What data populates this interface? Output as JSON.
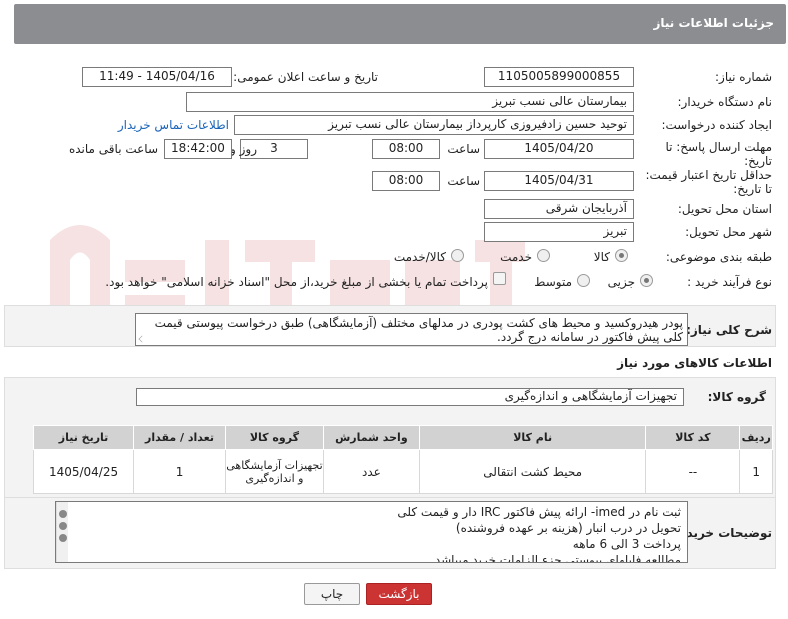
{
  "header": {
    "title": "جزئیات اطلاعات نیاز"
  },
  "fields": {
    "need_number": {
      "label": "شماره نیاز:",
      "value": "1105005899000855"
    },
    "announce_datetime": {
      "label": "تاریخ و ساعت اعلان عمومی:",
      "value": "1405/04/16 - 11:49"
    },
    "buyer_org": {
      "label": "نام دستگاه خریدار:",
      "value": "بیمارستان عالی نسب تبریز"
    },
    "requester": {
      "label": "ایجاد کننده درخواست:",
      "value": "توحید حسین زادفیروزی کارپرداز بیمارستان عالی نسب تبریز",
      "contact_link": "اطلاعات تماس خریدار"
    },
    "deadline": {
      "label_line1": "مهلت ارسال پاسخ: تا",
      "label_line2": "تاریخ:",
      "date": "1405/04/20",
      "time_label": "ساعت",
      "time": "08:00",
      "days": "3",
      "days_label": "روز و",
      "remaining_time": "18:42:00",
      "remaining_label": "ساعت باقی مانده"
    },
    "price_validity": {
      "label_line1": "حداقل تاریخ اعتبار قیمت:",
      "label_line2": "تا تاریخ:",
      "date": "1405/04/31",
      "time_label": "ساعت",
      "time": "08:00"
    },
    "delivery_province": {
      "label": "استان محل تحویل:",
      "value": "آذربایجان شرقی"
    },
    "delivery_city": {
      "label": "شهر محل تحویل:",
      "value": "تبریز"
    },
    "subject_category": {
      "label": "طبقه بندی موضوعی:",
      "options": [
        "کالا",
        "خدمت",
        "کالا/خدمت"
      ],
      "selected": "کالا"
    },
    "purchase_type": {
      "label": "نوع فرآیند خرید :",
      "options": [
        "جزیی",
        "متوسط"
      ],
      "selected": "جزیی",
      "payment_note": "پرداخت تمام یا بخشی از مبلغ خرید،از محل \"اسناد خزانه اسلامی\" خواهد بود."
    },
    "general_description": {
      "label": "شرح کلی نیاز:",
      "value": "پودر هیدروکسید و محیط های کشت پودری در مدلهای مختلف (آزمایشگاهی) طبق درخواست پیوستی قیمت کلی پیش فاکتور در سامانه درج گردد."
    }
  },
  "goods": {
    "section_title": "اطلاعات کالاهای مورد نیاز",
    "group_label": "گروه کالا:",
    "group_value": "تجهیزات آزمایشگاهی و اندازه‌گیری",
    "columns": [
      "ردیف",
      "کد کالا",
      "نام کالا",
      "واحد شمارش",
      "گروه کالا",
      "تعداد / مقدار",
      "تاریخ نیاز"
    ],
    "rows": [
      {
        "row": "1",
        "code": "--",
        "name": "محیط کشت انتقالی",
        "unit": "عدد",
        "group": "تجهیزات آزمایشگاهی و اندازه‌گیری",
        "quantity": "1",
        "date": "1405/04/25"
      }
    ]
  },
  "buyer_notes": {
    "label": "توضیحات خریدار:",
    "lines": [
      "ثبت نام در imed- ارائه پیش فاکتور IRC دار و قیمت کلی",
      "تحویل در درب انبار (هزینه بر عهده فروشنده)",
      "پرداخت  3 الی 6 ماهه",
      "مطالعه فایلهای پیوستی جزء الزامات خرید میباشد"
    ]
  },
  "buttons": {
    "print": "چاپ",
    "back": "بازگشت"
  },
  "colors": {
    "header_bg": "#8b8d91",
    "back_button": "#cc3333",
    "link": "#1a64b8",
    "watermark": "#c0272d"
  }
}
